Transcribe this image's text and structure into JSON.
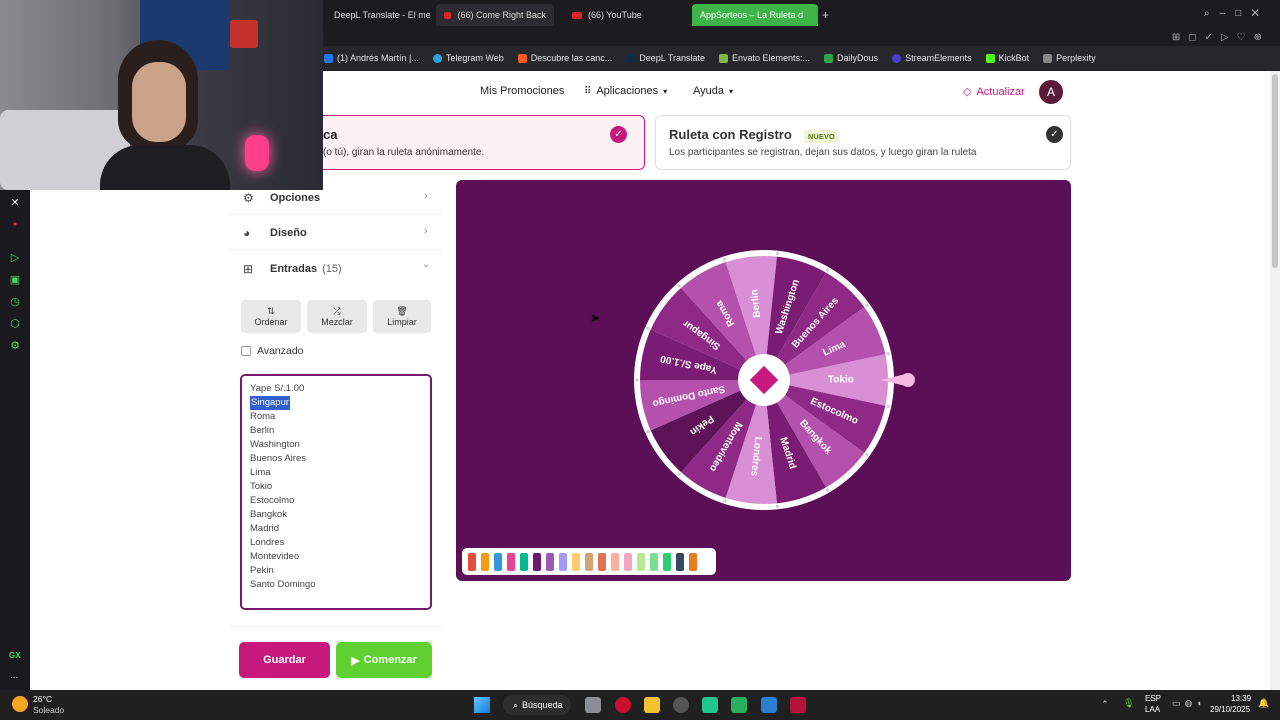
{
  "browser": {
    "tabs": [
      {
        "label": "DeepL Translate - El mejo"
      },
      {
        "label": "(66) Come Right Back"
      },
      {
        "label": "(66) YouTube"
      },
      {
        "label": "AppSorteos – La Ruleta d"
      }
    ],
    "new_tab": "+",
    "bookmarks": [
      {
        "label": "(1) Andrés Martín |...",
        "color": "#1877f2"
      },
      {
        "label": "Telegram Web",
        "color": "#2aa3df"
      },
      {
        "label": "Descubre las canc...",
        "color": "#ff5a1f"
      },
      {
        "label": "DeepL Translate",
        "color": "#0f2b46"
      },
      {
        "label": "Envato Elements:...",
        "color": "#82b541"
      },
      {
        "label": "DailyDous",
        "color": "#2ea44f"
      },
      {
        "label": "StreamElements",
        "color": "#4e3bd2"
      },
      {
        "label": "KickBot",
        "color": "#53fc18"
      },
      {
        "label": "Perplexity",
        "color": "#888888"
      }
    ],
    "sidebar_icons": [
      "x-icon",
      "vpn-icon",
      "play-icon",
      "wallet-icon",
      "clock-icon",
      "extension-icon",
      "settings-icon"
    ],
    "sidebar_footer": [
      "GX",
      "..."
    ]
  },
  "header": {
    "promotions": "Mis Promociones",
    "apps": "Aplicaciones",
    "help": "Ayuda",
    "upgrade": "Actualizar",
    "avatar": "A"
  },
  "modes": {
    "left_title_partial": "ca",
    "left_desc": "(o tú), giran la ruleta anónimamente.",
    "right_title": "Ruleta con Registro",
    "right_badge": "NUEVO",
    "right_desc": "Los participantes se registran, dejan sus datos, y luego giran la ruleta"
  },
  "panel": {
    "options": "Opciones",
    "design": "Diseño",
    "entries": "Entradas",
    "entries_count": "(15)",
    "sort": "Ordenar",
    "shuffle": "Mezclar",
    "clear": "Limpiar",
    "advanced": "Avanzado",
    "entries_list": [
      "Yape S/.1.00",
      "Singapur",
      "Roma",
      "Berlin",
      "Washington",
      "Buenos Aires",
      "Lima",
      "Tokio",
      "Estocolmo",
      "Bangkok",
      "Madrid",
      "Londres",
      "Montevideo",
      "Pekin",
      "Santo Domingo"
    ],
    "selected_entry": "Singapur",
    "save": "Guardar",
    "start": "Comenzar"
  },
  "wheel": {
    "segments": [
      "Tokio",
      "Estocolmo",
      "Bangkok",
      "Madrid",
      "Londres",
      "Montevideo",
      "Pekin",
      "Santo Domingo",
      "Yape S/.1.00",
      "Singapur",
      "Roma",
      "Berlin",
      "Washington",
      "Buenos Aires",
      "Lima"
    ],
    "colors": [
      "#d98fd6",
      "#8e2a86",
      "#b351ad",
      "#7a1c73",
      "#d98fd6",
      "#8e2a86",
      "#5e1258",
      "#b351ad",
      "#7a1c73",
      "#8e2a86",
      "#b351ad",
      "#d98fd6",
      "#7a1c73",
      "#8e2a86",
      "#b351ad"
    ],
    "background": "#5b0f56"
  },
  "palette": [
    "#e74c3c",
    "#f39c12",
    "#3498db",
    "#e84393",
    "#00b894",
    "#6c1a6e",
    "#9b59b6",
    "#a29bfe",
    "#fdcb6e",
    "#d4a373",
    "#e17055",
    "#fab1a0",
    "#f8a5c2",
    "#b8e994",
    "#78e08f",
    "#2ecc71",
    "#34495e",
    "#e67e22"
  ],
  "taskbar": {
    "temp": "26°C",
    "weather": "Soleado",
    "search": "Búsqueda",
    "lang1": "ESP",
    "lang2": "LAA",
    "time": "13:39",
    "date": "29/10/2025"
  }
}
